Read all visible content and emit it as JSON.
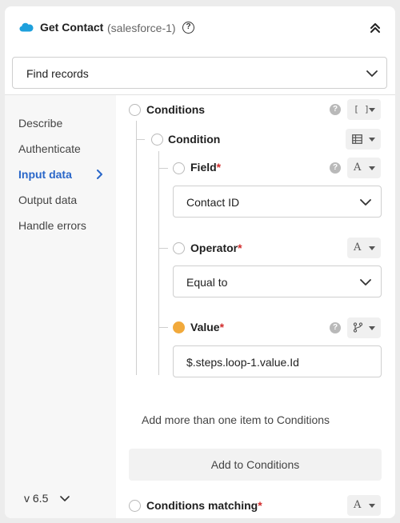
{
  "header": {
    "title": "Get Contact",
    "subtitle": "(salesforce-1)",
    "help": "?",
    "icons": {
      "brand": "salesforce-cloud-icon",
      "collapse": "double-chevron-up-icon"
    }
  },
  "action_select": {
    "value": "Find records"
  },
  "sidebar": {
    "items": [
      {
        "label": "Describe"
      },
      {
        "label": "Authenticate"
      },
      {
        "label": "Input data"
      },
      {
        "label": "Output data"
      },
      {
        "label": "Handle errors"
      }
    ],
    "active_index": 2,
    "version": "v 6.5"
  },
  "content": {
    "conditions": {
      "label": "Conditions",
      "help": "?",
      "type_glyph": "[ ]"
    },
    "condition": {
      "label": "Condition",
      "type_icon": "table-icon"
    },
    "field": {
      "label": "Field",
      "required_mark": "*",
      "help": "?",
      "type_glyph": "A",
      "value": "Contact ID"
    },
    "operator": {
      "label": "Operator",
      "required_mark": "*",
      "type_glyph": "A",
      "value": "Equal to"
    },
    "value": {
      "label": "Value",
      "required_mark": "*",
      "help": "?",
      "type_icon": "branch-icon",
      "input": "$.steps.loop-1.value.Id"
    },
    "hint": "Add more than one item to Conditions",
    "add_button": "Add to Conditions",
    "conditions_matching": {
      "label": "Conditions matching",
      "required_mark": "*",
      "type_glyph": "A"
    }
  },
  "colors": {
    "accent": "#2a67c9",
    "required": "#d12b2b",
    "value_dot": "#f1a93b"
  }
}
